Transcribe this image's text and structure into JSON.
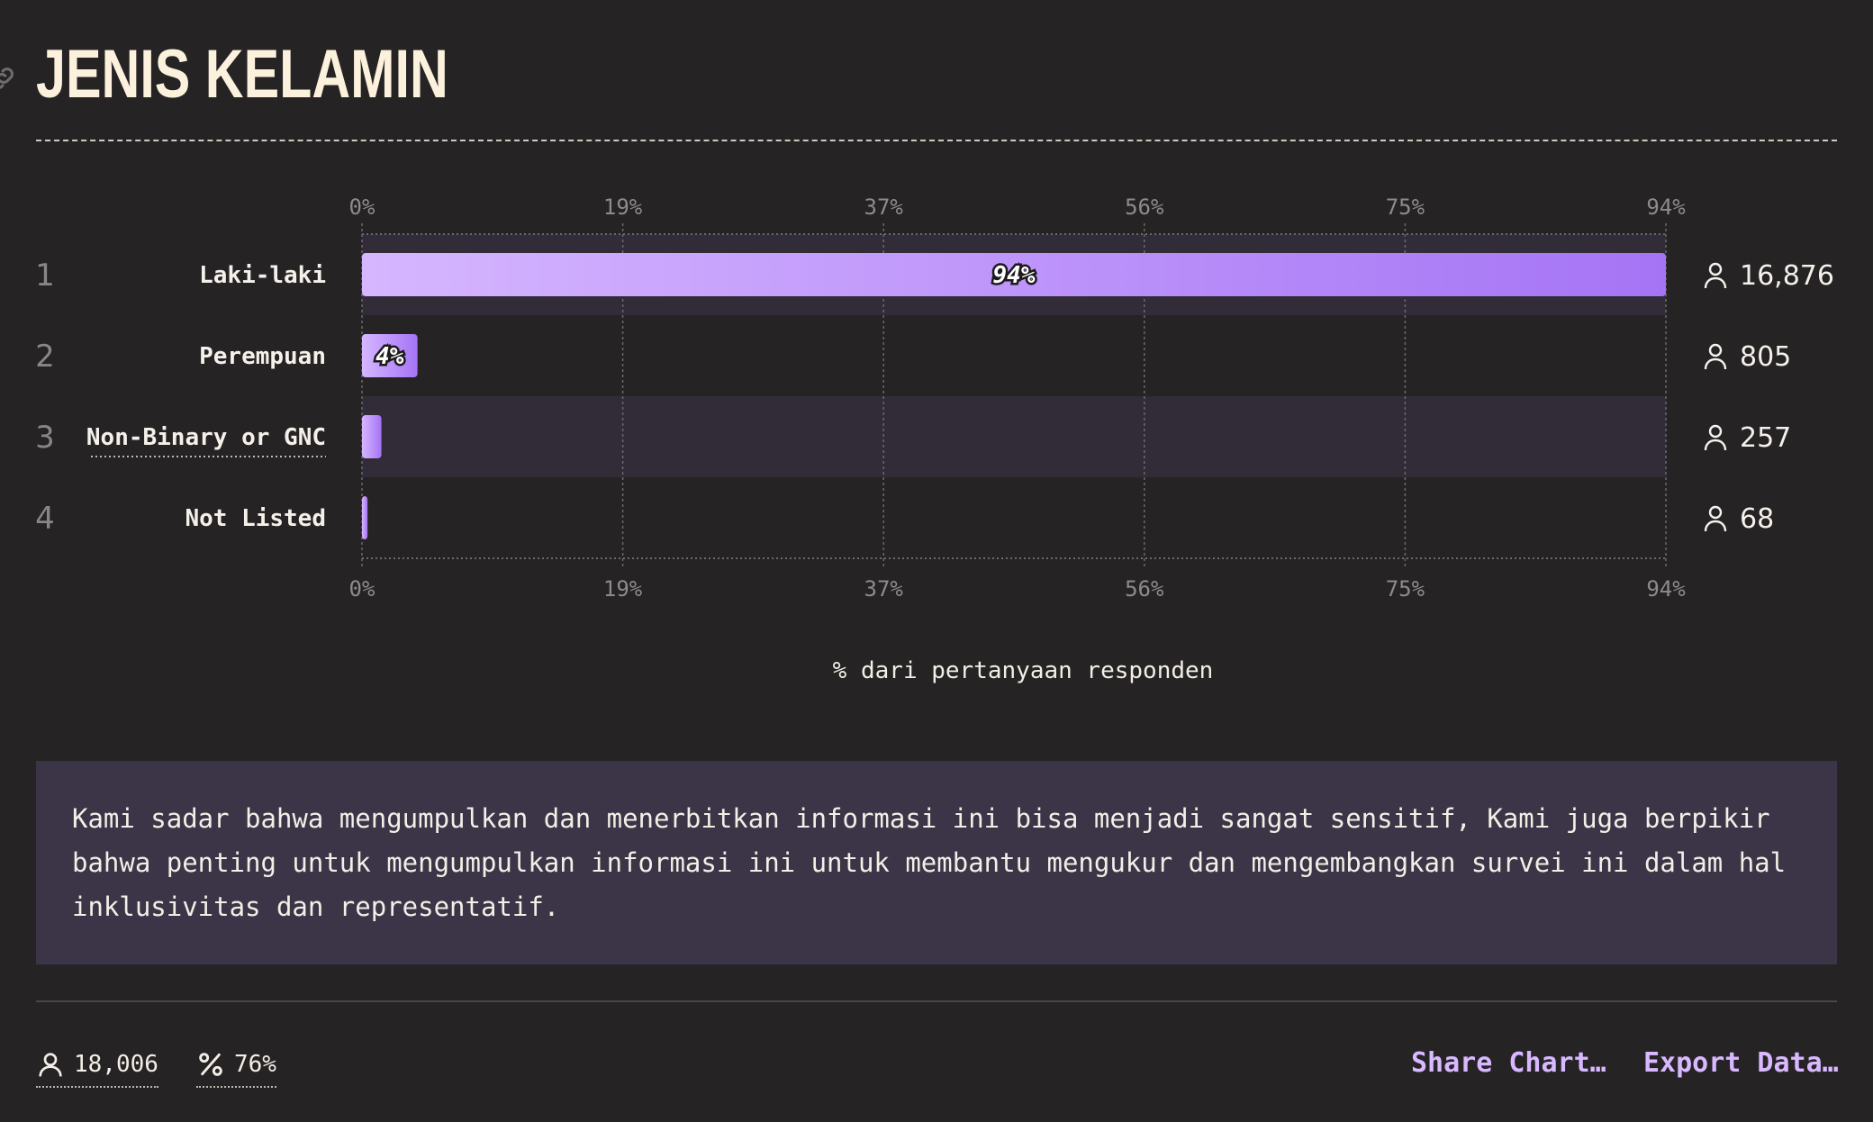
{
  "title": "JENIS KELAMIN",
  "chart_data": {
    "type": "bar",
    "orientation": "horizontal",
    "categories": [
      "Laki-laki",
      "Perempuan",
      "Non-Binary or GNC",
      "Not Listed"
    ],
    "ranks": [
      "1",
      "2",
      "3",
      "4"
    ],
    "values": [
      94,
      4,
      1.4,
      0.4
    ],
    "value_labels": [
      "94%",
      "4%",
      "",
      ""
    ],
    "counts": [
      "16,876",
      "805",
      "257",
      "68"
    ],
    "xlim": [
      0,
      94
    ],
    "ticks": [
      0,
      18.8,
      37.6,
      56.4,
      75.2,
      94
    ],
    "tick_labels": [
      "0%",
      "19%",
      "37%",
      "56%",
      "75%",
      "94%"
    ],
    "xlabel": "% dari pertanyaan responden",
    "grid": true,
    "bar_color_start": "#d6b6ff",
    "bar_color_end": "#a574f5"
  },
  "note": "Kami sadar bahwa mengumpulkan dan menerbitkan informasi ini bisa menjadi sangat sensitif, Kami juga berpikir bahwa penting untuk mengumpulkan informasi ini untuk membantu mengukur dan mengembangkan survei ini dalam hal inklusivitas dan representatif.",
  "footer": {
    "respondents": "18,006",
    "percentage": "76%",
    "share_label": "Share Chart…",
    "export_label": "Export Data…"
  },
  "colors": {
    "background": "#262325",
    "accent": "#d8b8ff",
    "note_bg": "#3c3548"
  },
  "icons": {
    "respondent": "user-icon",
    "percent": "percent-icon",
    "link": "link-icon"
  }
}
